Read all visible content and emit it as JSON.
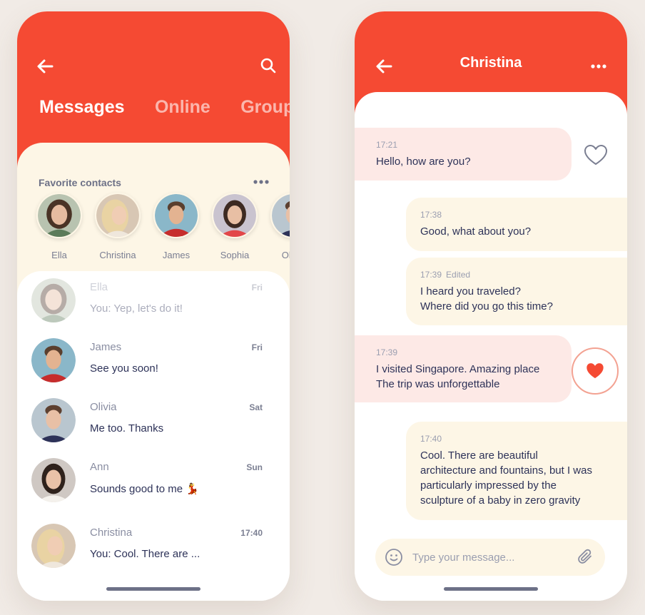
{
  "colors": {
    "accent": "#f54a33",
    "cream": "#fdf6e6",
    "pink": "#fde9e6",
    "text_dark": "#2d3258",
    "text_muted": "#8a8ea2",
    "background": "#f1ebe6"
  },
  "list_screen": {
    "tabs": [
      {
        "label": "Messages",
        "active": true
      },
      {
        "label": "Online",
        "active": false
      },
      {
        "label": "Groups",
        "active": false
      }
    ],
    "favorites_title": "Favorite contacts",
    "favorites": [
      {
        "name": "Ella"
      },
      {
        "name": "Christina"
      },
      {
        "name": "James"
      },
      {
        "name": "Sophia"
      },
      {
        "name": "Olivia"
      }
    ],
    "conversations": [
      {
        "name": "Ella",
        "time": "Fri",
        "message": "You: Yep, let's do it!"
      },
      {
        "name": "James",
        "time": "Fri",
        "message": "See you soon!"
      },
      {
        "name": "Olivia",
        "time": "Sat",
        "message": "Me too. Thanks"
      },
      {
        "name": "Ann",
        "time": "Sun",
        "message": "Sounds good to me 💃"
      },
      {
        "name": "Christina",
        "time": "17:40",
        "message": "You: Cool. There are ..."
      }
    ]
  },
  "chat_screen": {
    "title": "Christina",
    "messages": [
      {
        "time": "17:21",
        "text": "Hello, how are you?",
        "direction": "incoming"
      },
      {
        "time": "17:38",
        "text": "Good, what about you?",
        "direction": "outgoing"
      },
      {
        "time": "17:39",
        "edited": "Edited",
        "lines": [
          "I heard you traveled?",
          "Where did you go this time?"
        ],
        "direction": "outgoing"
      },
      {
        "time": "17:39",
        "lines": [
          "I visited Singapore. Amazing place",
          "The trip was unforgettable"
        ],
        "direction": "incoming",
        "liked": true
      },
      {
        "time": "17:40",
        "lines": [
          "Cool. There are beautiful",
          "architecture and fountains, but I was",
          "particularly impressed by the",
          "sculpture of a baby in zero gravity"
        ],
        "direction": "outgoing"
      }
    ],
    "input_placeholder": "Type your message..."
  }
}
